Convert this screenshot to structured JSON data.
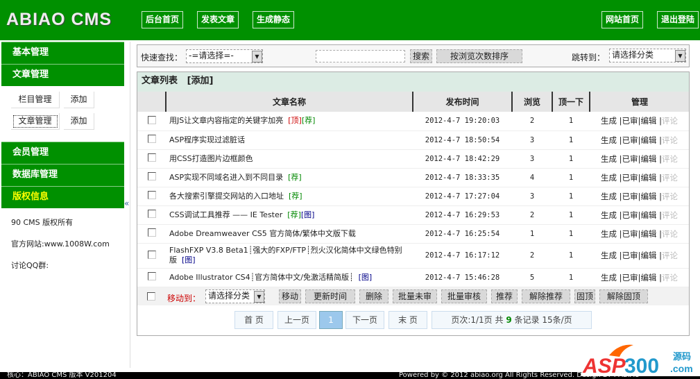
{
  "header": {
    "logo": "ABIAO CMS",
    "nav": [
      "后台首页",
      "发表文章",
      "生成静态"
    ],
    "right": [
      "网站首页",
      "退出登陆"
    ]
  },
  "sidebar": {
    "sections": [
      {
        "label": "基本管理"
      },
      {
        "label": "文章管理"
      }
    ],
    "sub": [
      {
        "label": "栏目管理",
        "add": "添加"
      },
      {
        "label": "文章管理",
        "add": "添加"
      }
    ],
    "sections2": [
      {
        "label": "会员管理"
      },
      {
        "label": "数据库管理"
      },
      {
        "label": "版权信息"
      }
    ],
    "info": [
      "90 CMS 版权所有",
      "官方网站:www.1008W.com",
      "讨论QQ群:"
    ],
    "collapse": "«"
  },
  "toolbar": {
    "quick_label": "快速查找：",
    "quick_select": "-=请选择=-",
    "search_value": "",
    "search_btn": "搜索",
    "sort_btn": "按浏览次数排序",
    "jump_label": "跳转到：",
    "jump_select": "请选择分类"
  },
  "list": {
    "title": "文章列表",
    "add": "[添加]",
    "columns": [
      "文章名称",
      "发布时间",
      "浏览",
      "顶一下",
      "管理"
    ],
    "rows": [
      {
        "title": "用JS让文章内容指定的关键字加亮",
        "tags": [
          [
            "[顶]",
            "top"
          ],
          [
            "[荐]",
            "rec"
          ]
        ],
        "time": "2012-4-7 19:20:03",
        "views": "2",
        "up": "1"
      },
      {
        "title": "ASP程序实现过滤脏话",
        "tags": [],
        "time": "2012-4-7 18:50:54",
        "views": "3",
        "up": "1"
      },
      {
        "title": "用CSS打造图片边框颜色",
        "tags": [],
        "time": "2012-4-7 18:42:29",
        "views": "3",
        "up": "1"
      },
      {
        "title": "ASP实现不同域名进入到不同目录",
        "tags": [
          [
            "[荐]",
            "rec"
          ]
        ],
        "time": "2012-4-7 18:33:35",
        "views": "4",
        "up": "1"
      },
      {
        "title": "各大搜索引擎提交网站的入口地址",
        "tags": [
          [
            "[荐]",
            "rec"
          ]
        ],
        "time": "2012-4-7 17:27:04",
        "views": "3",
        "up": "1"
      },
      {
        "title": "CSS调试工具推荐 —— IE Tester",
        "tags": [
          [
            "[荐]",
            "rec"
          ],
          [
            "[图]",
            "img"
          ]
        ],
        "time": "2012-4-7 16:29:53",
        "views": "2",
        "up": "1"
      },
      {
        "title": "Adobe Dreamweaver CS5 官方简体/繁体中文版下载",
        "tags": [],
        "time": "2012-4-7 16:25:54",
        "views": "1",
        "up": "1"
      },
      {
        "title": "FlashFXP V3.8 Beta1┊强大的FXP/FTP┊烈火汉化简体中文绿色特别版",
        "tags": [
          [
            "[图]",
            "img"
          ]
        ],
        "time": "2012-4-7 16:17:12",
        "views": "2",
        "up": "1"
      },
      {
        "title": "Adobe Illustrator CS4┊官方简体中文/免激活精简版┊",
        "tags": [
          [
            "[图]",
            "img"
          ]
        ],
        "time": "2012-4-7 15:46:28",
        "views": "5",
        "up": "1"
      }
    ],
    "manage": [
      "生成",
      "已审",
      "编辑",
      "评论"
    ],
    "move_label": "移动到：",
    "move_select": "请选择分类",
    "actions": [
      "移动",
      "更新时间",
      "删除",
      "批量未审",
      "批量审核",
      "推荐",
      "解除推荐",
      "固顶",
      "解除固顶"
    ]
  },
  "pager": {
    "first": "首 页",
    "prev": "上一页",
    "current": "1",
    "next": "下一页",
    "last": "末 页",
    "info_a": "页次:1/1页 共",
    "total": "9",
    "info_b": "条记录 15条/页"
  },
  "footer": {
    "left": "核心：ABIAO CMS 版本 V201204",
    "right": "Powered by © 2012 abiao.org All Rights Reserved. Design BY : ABIAO"
  },
  "watermark": "ASP300源码 .com",
  "colors": {
    "brand_green": "#009000",
    "title_bg": "#dcece4",
    "top_tag": "#cc0000",
    "rec_tag": "#008800",
    "img_tag": "#000088"
  }
}
